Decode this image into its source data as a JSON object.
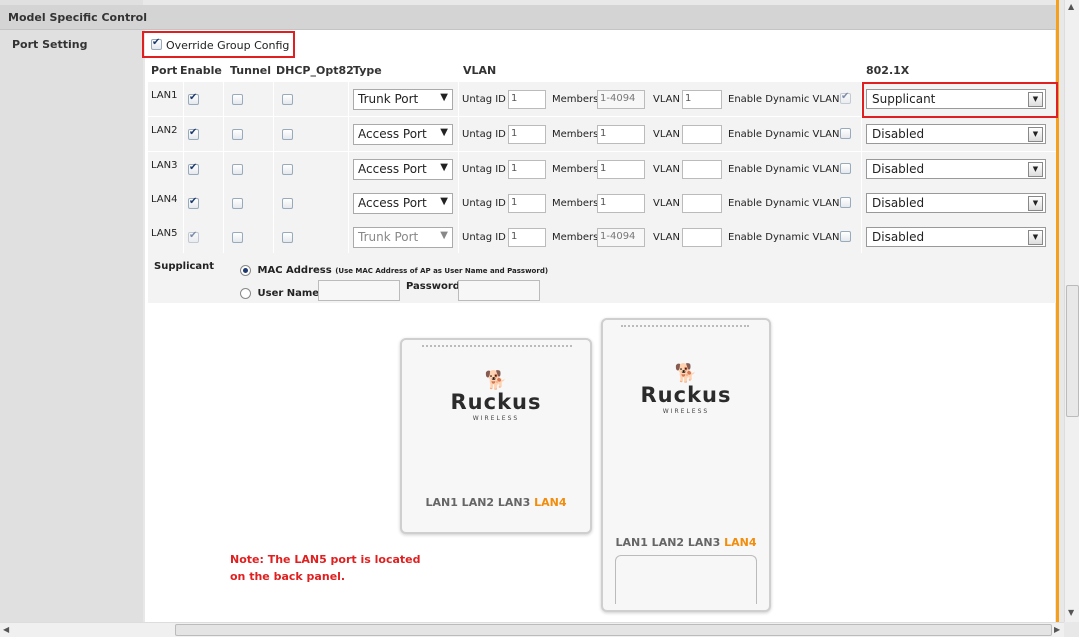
{
  "section_title": "Model Specific Control",
  "port_setting_label": "Port Setting",
  "override": {
    "label": "Override Group Config",
    "checked": true
  },
  "headers": {
    "port": "Port",
    "enable": "Enable",
    "tunnel": "Tunnel",
    "dhcp": "DHCP_Opt82",
    "type": "Type",
    "vlan": "VLAN",
    "dot1x": "802.1X"
  },
  "labels": {
    "untag_id": "Untag ID",
    "members": "Members",
    "vlan": "VLAN",
    "enable_dynamic_vlan": "Enable Dynamic VLAN"
  },
  "rows": [
    {
      "port": "LAN1",
      "type": "Trunk Port",
      "untag": "1",
      "members": "1-4094",
      "vlan": "1",
      "dot1x": "Supplicant"
    },
    {
      "port": "LAN2",
      "type": "Access Port",
      "untag": "1",
      "members": "1",
      "vlan": "",
      "dot1x": "Disabled"
    },
    {
      "port": "LAN3",
      "type": "Access Port",
      "untag": "1",
      "members": "1",
      "vlan": "",
      "dot1x": "Disabled"
    },
    {
      "port": "LAN4",
      "type": "Access Port",
      "untag": "1",
      "members": "1",
      "vlan": "",
      "dot1x": "Disabled"
    },
    {
      "port": "LAN5",
      "type": "Trunk Port",
      "untag": "1",
      "members": "1-4094",
      "vlan": "",
      "dot1x": "Disabled"
    }
  ],
  "supplicant": {
    "label": "Supplicant",
    "mac_label": "MAC Address",
    "mac_hint": "(Use MAC Address of AP as User Name and Password)",
    "user_label": "User Name",
    "password_label": "Password",
    "user_value": "",
    "password_value": ""
  },
  "device1": {
    "brand": "Ruckus",
    "sub": "WIRELESS",
    "ports": "LAN1 LAN2 LAN3",
    "port_hl": "LAN4"
  },
  "device2": {
    "brand": "Ruckus",
    "sub": "WIRELESS",
    "ports": "LAN1 LAN2 LAN3",
    "port_hl": "LAN4"
  },
  "note": "Note: The LAN5 port is located on the back panel.",
  "colors": {
    "accent_orange": "#f4a01d",
    "highlight_red": "#e02020",
    "lan4_orange": "#f28c0b"
  }
}
